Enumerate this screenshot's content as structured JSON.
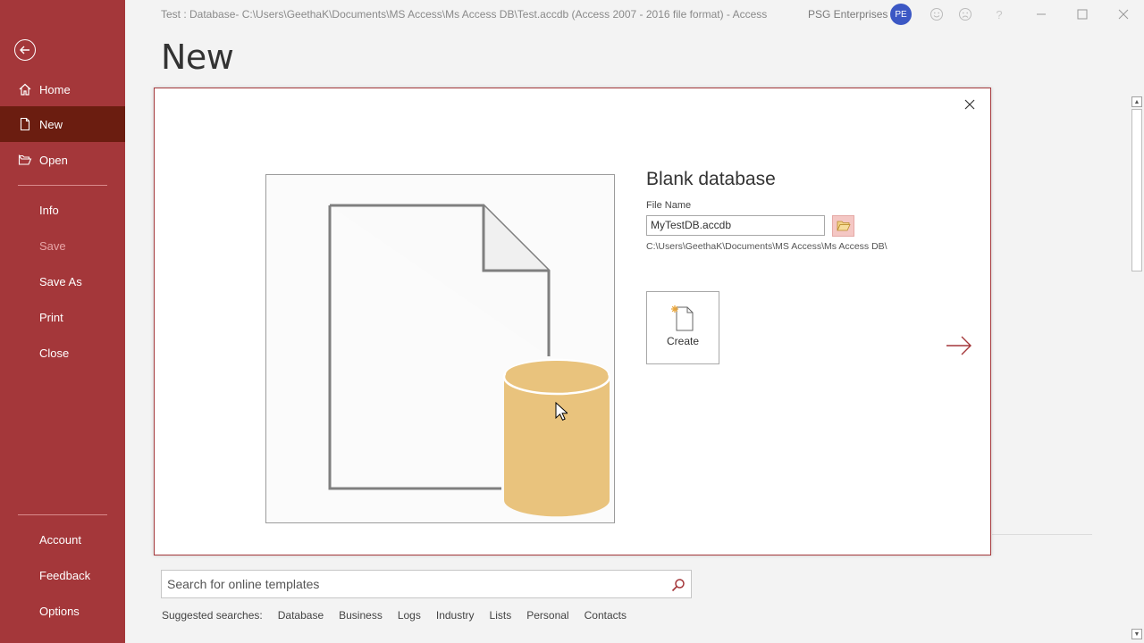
{
  "window": {
    "title": "Test : Database- C:\\Users\\GeethaK\\Documents\\MS Access\\Ms Access DB\\Test.accdb (Access 2007 - 2016 file format)  -  Access",
    "org": "PSG Enterprises",
    "avatar_initials": "PE"
  },
  "sidebar": {
    "items": [
      {
        "label": "Home",
        "icon": "home-icon"
      },
      {
        "label": "New",
        "icon": "new-document-icon",
        "active": true
      },
      {
        "label": "Open",
        "icon": "open-folder-icon"
      },
      {
        "label": "Info"
      },
      {
        "label": "Save",
        "disabled": true
      },
      {
        "label": "Save As"
      },
      {
        "label": "Print"
      },
      {
        "label": "Close"
      },
      {
        "label": "Account"
      },
      {
        "label": "Feedback"
      },
      {
        "label": "Options"
      }
    ]
  },
  "page": {
    "title": "New"
  },
  "dialog": {
    "heading": "Blank database",
    "file_name_label": "File Name",
    "file_name_value": "MyTestDB.accdb",
    "path": "C:\\Users\\GeethaK\\Documents\\MS Access\\Ms Access DB\\",
    "create_label": "Create"
  },
  "search": {
    "placeholder": "Search for online templates",
    "suggested_label": "Suggested searches:",
    "suggestions": [
      "Database",
      "Business",
      "Logs",
      "Industry",
      "Lists",
      "Personal",
      "Contacts"
    ]
  },
  "colors": {
    "accent": "#a4373a",
    "accent_dark": "#6b1d10",
    "db_gold": "#e9c37d"
  }
}
